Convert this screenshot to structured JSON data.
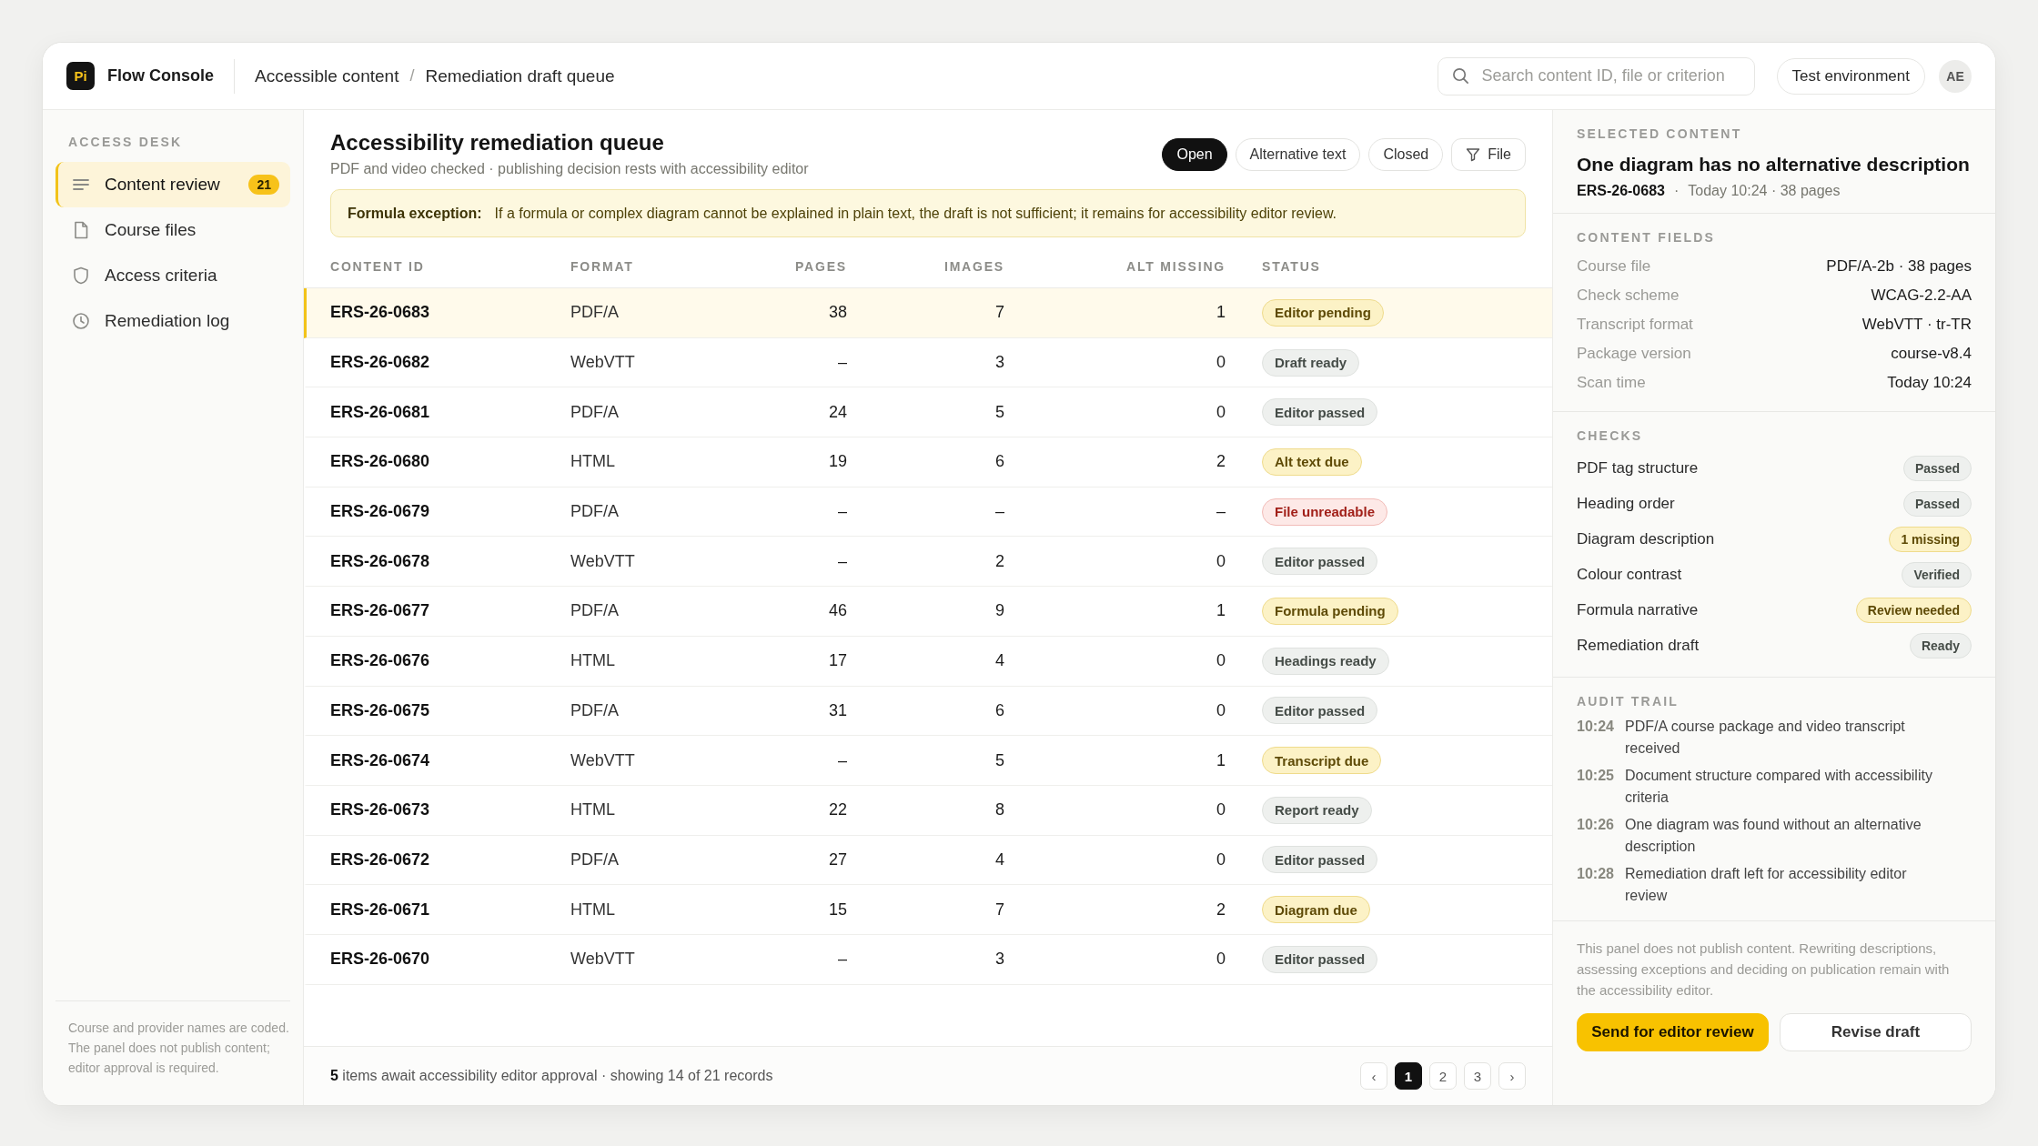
{
  "app": {
    "logo": "Pi",
    "name": "Flow Console"
  },
  "breadcrumb": {
    "items": [
      "Accessible content",
      "Remediation draft queue"
    ],
    "separator": "/"
  },
  "search": {
    "placeholder": "Search content ID, file or criterion"
  },
  "environment": "Test environment",
  "avatar": "AE",
  "sidebar": {
    "heading": "ACCESS DESK",
    "items": [
      {
        "label": "Content review",
        "count": "21",
        "selected": true
      },
      {
        "label": "Course files",
        "selected": false
      },
      {
        "label": "Access criteria",
        "selected": false
      },
      {
        "label": "Remediation log",
        "selected": false
      }
    ],
    "note": "Course and provider names are coded. The panel does not publish content; editor approval is required."
  },
  "queue": {
    "title": "Accessibility remediation queue",
    "subtitle": "PDF and video checked · publishing decision rests with accessibility editor",
    "filters": [
      {
        "label": "Open",
        "selected": true
      },
      {
        "label": "Alternative text",
        "selected": false
      },
      {
        "label": "Closed",
        "selected": false
      }
    ],
    "filter_button": "File",
    "notice": {
      "label": "Formula exception:",
      "text": "If a formula or complex diagram cannot be explained in plain text, the draft is not sufficient; it remains for accessibility editor review."
    },
    "columns": [
      "CONTENT ID",
      "FORMAT",
      "PAGES",
      "IMAGES",
      "ALT MISSING",
      "STATUS"
    ],
    "rows": [
      {
        "id": "ERS-26-0683",
        "format": "PDF/A",
        "pages": "38",
        "images": "7",
        "alt_missing": "1",
        "status": {
          "label": "Editor pending",
          "kind": "warning"
        },
        "selected": true
      },
      {
        "id": "ERS-26-0682",
        "format": "WebVTT",
        "pages": "–",
        "images": "3",
        "alt_missing": "0",
        "status": {
          "label": "Draft ready",
          "kind": "neutral"
        },
        "selected": false
      },
      {
        "id": "ERS-26-0681",
        "format": "PDF/A",
        "pages": "24",
        "images": "5",
        "alt_missing": "0",
        "status": {
          "label": "Editor passed",
          "kind": "neutral"
        },
        "selected": false
      },
      {
        "id": "ERS-26-0680",
        "format": "HTML",
        "pages": "19",
        "images": "6",
        "alt_missing": "2",
        "status": {
          "label": "Alt text due",
          "kind": "warning"
        },
        "selected": false
      },
      {
        "id": "ERS-26-0679",
        "format": "PDF/A",
        "pages": "–",
        "images": "–",
        "alt_missing": "–",
        "status": {
          "label": "File unreadable",
          "kind": "error"
        },
        "selected": false
      },
      {
        "id": "ERS-26-0678",
        "format": "WebVTT",
        "pages": "–",
        "images": "2",
        "alt_missing": "0",
        "status": {
          "label": "Editor passed",
          "kind": "neutral"
        },
        "selected": false
      },
      {
        "id": "ERS-26-0677",
        "format": "PDF/A",
        "pages": "46",
        "images": "9",
        "alt_missing": "1",
        "status": {
          "label": "Formula pending",
          "kind": "warning"
        },
        "selected": false
      },
      {
        "id": "ERS-26-0676",
        "format": "HTML",
        "pages": "17",
        "images": "4",
        "alt_missing": "0",
        "status": {
          "label": "Headings ready",
          "kind": "neutral"
        },
        "selected": false
      },
      {
        "id": "ERS-26-0675",
        "format": "PDF/A",
        "pages": "31",
        "images": "6",
        "alt_missing": "0",
        "status": {
          "label": "Editor passed",
          "kind": "neutral"
        },
        "selected": false
      },
      {
        "id": "ERS-26-0674",
        "format": "WebVTT",
        "pages": "–",
        "images": "5",
        "alt_missing": "1",
        "status": {
          "label": "Transcript due",
          "kind": "warning"
        },
        "selected": false
      },
      {
        "id": "ERS-26-0673",
        "format": "HTML",
        "pages": "22",
        "images": "8",
        "alt_missing": "0",
        "status": {
          "label": "Report ready",
          "kind": "neutral"
        },
        "selected": false
      },
      {
        "id": "ERS-26-0672",
        "format": "PDF/A",
        "pages": "27",
        "images": "4",
        "alt_missing": "0",
        "status": {
          "label": "Editor passed",
          "kind": "neutral"
        },
        "selected": false
      },
      {
        "id": "ERS-26-0671",
        "format": "HTML",
        "pages": "15",
        "images": "7",
        "alt_missing": "2",
        "status": {
          "label": "Diagram due",
          "kind": "warning"
        },
        "selected": false
      },
      {
        "id": "ERS-26-0670",
        "format": "WebVTT",
        "pages": "–",
        "images": "3",
        "alt_missing": "0",
        "status": {
          "label": "Editor passed",
          "kind": "neutral"
        },
        "selected": false
      }
    ],
    "footer": "**5** items await accessibility editor approval · showing 14 of 21 records",
    "pagination": {
      "prev": "‹",
      "pages": [
        {
          "label": "1",
          "selected": true
        },
        {
          "label": "2",
          "selected": false
        },
        {
          "label": "3",
          "selected": false
        }
      ],
      "next": "›"
    }
  },
  "detail": {
    "heading": "SELECTED CONTENT",
    "title": "One diagram has no alternative description",
    "id": "ERS-26-0683",
    "separator": "·",
    "meta": "Today 10:24 · 38 pages",
    "fields_heading": "CONTENT FIELDS",
    "fields": [
      {
        "label": "Course file",
        "value": "PDF/A-2b · 38 pages"
      },
      {
        "label": "Check scheme",
        "value": "WCAG-2.2-AA"
      },
      {
        "label": "Transcript format",
        "value": "WebVTT · tr-TR"
      },
      {
        "label": "Package version",
        "value": "course-v8.4"
      },
      {
        "label": "Scan time",
        "value": "Today 10:24"
      }
    ],
    "checks_heading": "CHECKS",
    "checks": [
      {
        "label": "PDF tag structure",
        "status": {
          "label": "Passed",
          "kind": "neutral"
        }
      },
      {
        "label": "Heading order",
        "status": {
          "label": "Passed",
          "kind": "neutral"
        }
      },
      {
        "label": "Diagram description",
        "status": {
          "label": "1 missing",
          "kind": "warning"
        }
      },
      {
        "label": "Colour contrast",
        "status": {
          "label": "Verified",
          "kind": "neutral"
        }
      },
      {
        "label": "Formula narrative",
        "status": {
          "label": "Review needed",
          "kind": "warning"
        }
      },
      {
        "label": "Remediation draft",
        "status": {
          "label": "Ready",
          "kind": "neutral"
        }
      }
    ],
    "audit_heading": "AUDIT TRAIL",
    "audit": [
      {
        "time": "10:24",
        "text": "PDF/A course package and video transcript received"
      },
      {
        "time": "10:25",
        "text": "Document structure compared with accessibility criteria"
      },
      {
        "time": "10:26",
        "text": "One diagram was found without an alternative description"
      },
      {
        "time": "10:28",
        "text": "Remediation draft left for accessibility editor review"
      }
    ],
    "note": "This panel does not publish content. Rewriting descriptions, assessing exceptions and deciding on publication remain with the accessibility editor.",
    "buttons": [
      {
        "label": "Send for editor review",
        "kind": "primary"
      },
      {
        "label": "Revise draft",
        "kind": "secondary"
      }
    ]
  }
}
